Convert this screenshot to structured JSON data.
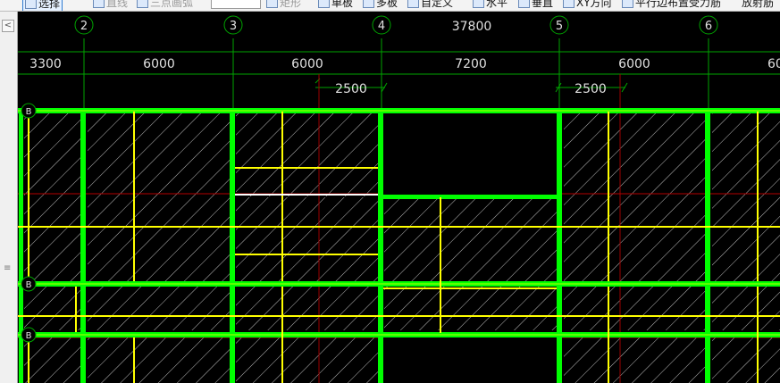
{
  "toolbar": {
    "select_label": "选择",
    "line_label": "直线",
    "arc_label": "三点画弧",
    "rect_label": "矩形",
    "single_board_label": "单板",
    "multi_board_label": "多板",
    "custom_label": "自定义",
    "horizontal_label": "水平",
    "vertical_label": "垂直",
    "xy_direction_label": "XY方向",
    "parallel_edge_label": "平行边布置受力筋",
    "radial_label": "放射筋"
  },
  "sidebar": {
    "button_label": "<",
    "grip_label": "≡"
  },
  "drawing": {
    "axes": [
      "2",
      "3",
      "4",
      "5",
      "6"
    ],
    "total_dimension": "37800",
    "dimensions": [
      "3300",
      "6000",
      "6000",
      "7200",
      "6000",
      "60"
    ],
    "sub_dimensions": [
      "2500",
      "2500"
    ],
    "row_markers": [
      "B",
      "B",
      "B"
    ]
  },
  "colors": {
    "beam": "#00ff00",
    "inner_beam": "#b6ff00",
    "rebar": "#ffff00",
    "highlight": "#ffffff",
    "grid_line": "#00a400",
    "red_line": "#bf0000",
    "hatch": "#c7c7c7"
  }
}
